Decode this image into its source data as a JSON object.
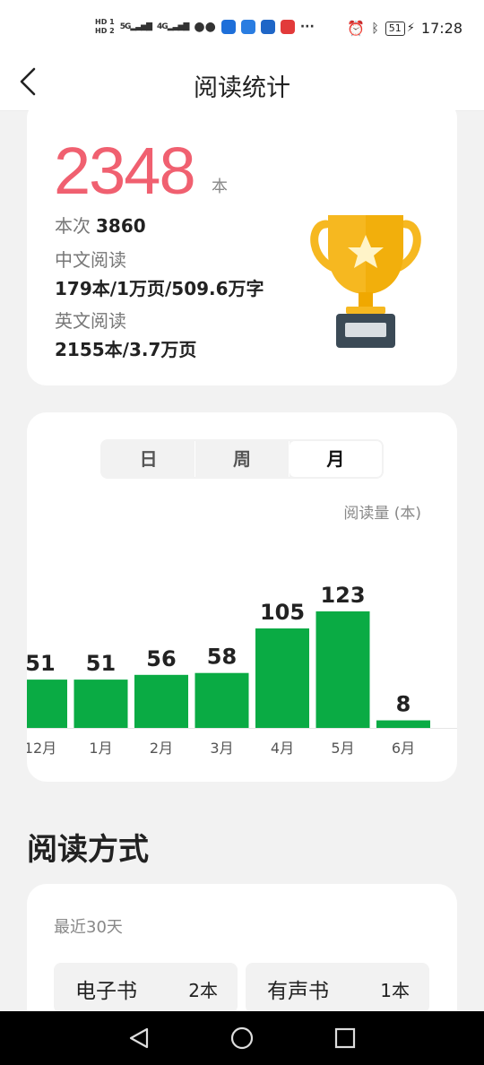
{
  "status_bar": {
    "hd1": "HD 1",
    "hd2": "HD 2",
    "net1": "5G",
    "net2": "4G",
    "more": "···",
    "battery": "51",
    "time": "17:28",
    "icons": [
      "signal-icon",
      "wechat-icon",
      "app-icon",
      "bulb-icon",
      "star-app-icon",
      "calendar-app-icon",
      "alarm-icon",
      "bluetooth-icon",
      "battery-icon",
      "charging-icon"
    ]
  },
  "nav": {
    "title": "阅读统计",
    "back_icon": "chevron-left-icon"
  },
  "summary": {
    "total": "2348",
    "total_unit": "本",
    "sessions_label": "本次",
    "sessions_value": "3860",
    "chinese_label": "中文阅读",
    "chinese_value": "179本/1万页/509.6万字",
    "english_label": "英文阅读",
    "english_value": "2155本/3.7万页",
    "trophy_icon": "trophy-icon"
  },
  "tabs": [
    {
      "label": "日",
      "active": false
    },
    {
      "label": "周",
      "active": false
    },
    {
      "label": "月",
      "active": true
    }
  ],
  "chart_data": {
    "type": "bar",
    "unit_label": "阅读量 (本)",
    "categories": [
      "12月",
      "1月",
      "2月",
      "3月",
      "4月",
      "5月",
      "6月"
    ],
    "values": [
      51,
      51,
      56,
      58,
      105,
      123,
      8
    ],
    "value_labels": [
      "51",
      "51",
      "56",
      "58",
      "105",
      "123",
      "8"
    ],
    "bar_color": "#0aab44",
    "ylim": [
      0,
      123
    ]
  },
  "section": {
    "title": "阅读方式"
  },
  "reading_mode": {
    "period": "最近30天",
    "items": [
      {
        "label": "电子书",
        "value": "2本"
      },
      {
        "label": "有声书",
        "value": "1本"
      }
    ]
  },
  "system_nav": {
    "back": "triangle-back-icon",
    "home": "circle-home-icon",
    "recent": "square-recent-icon"
  }
}
